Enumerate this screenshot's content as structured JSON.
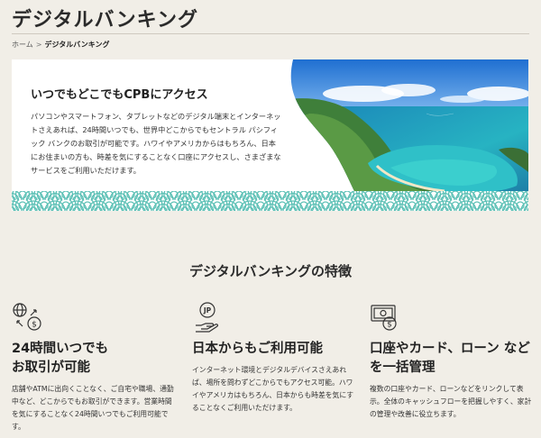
{
  "page": {
    "title": "デジタルバンキング"
  },
  "breadcrumb": {
    "home": "ホーム",
    "separator": ">",
    "current": "デジタルバンキング"
  },
  "hero": {
    "heading": "いつでもどこでもCPBにアクセス",
    "body": "パソコンやスマートフォン、タブレットなどのデジタル端末とインターネットさえあれば、24時間いつでも、世界中どこからでもセントラル パシフィック バンクのお取引が可能です。ハワイやアメリカからはもちろん、日本にお住まいの方も、時差を気にすることなく口座にアクセスし、さまざまなサービスをご利用いただけます。",
    "pattern_color": "#5bc0b5",
    "ocean_color": "#1f9bb0"
  },
  "features": {
    "title": "デジタルバンキングの特徴",
    "items": [
      {
        "icon": "globe-dollar-icon",
        "title": "24時間いつでも\nお取引が可能",
        "body": "店舗やATMに出向くことなく、ご自宅や職場、通勤中など、どこからでもお取引ができます。営業時間を気にすることなく24時間いつでもご利用可能です。"
      },
      {
        "icon": "jp-hand-icon",
        "title": "日本からもご利用可能",
        "body": "インターネット環境とデジタルデバイスさえあれば、場所を問わずどこからでもアクセス可能。ハワイやアメリカはもちろん、日本からも時差を気にすることなくご利用いただけます。"
      },
      {
        "icon": "card-account-icon",
        "title": "口座やカード、ローン などを一括管理",
        "body": "複数の口座やカード、ローンなどをリンクして表示。全体のキャッシュフローを把握しやすく、家計の管理や改善に役立ちます。"
      }
    ]
  }
}
